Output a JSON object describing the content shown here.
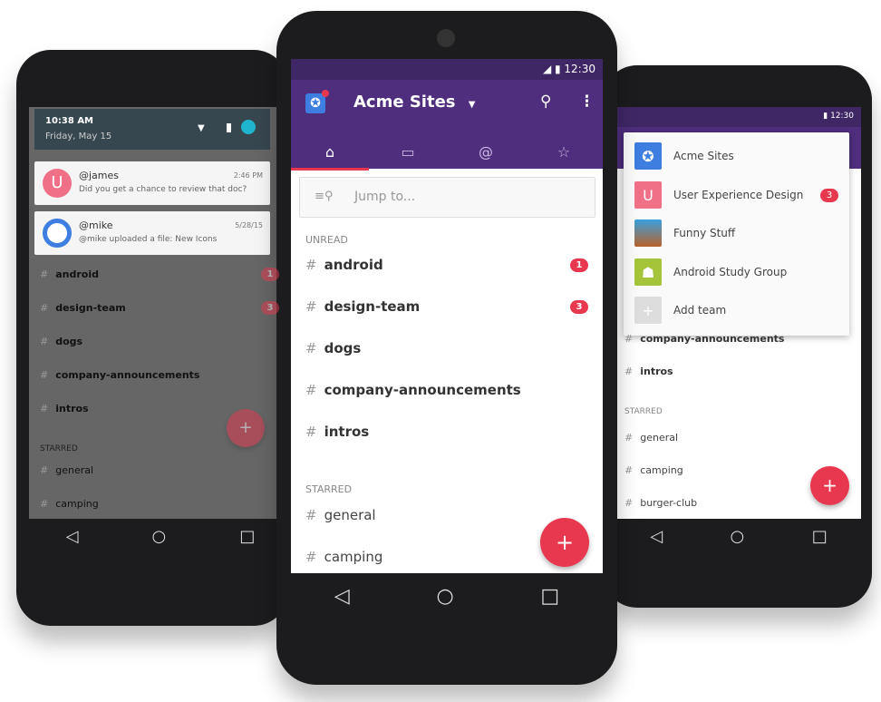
{
  "left": {
    "time": "10:38 AM",
    "date": "Friday, May 15",
    "notifications": [
      {
        "user": "@james",
        "time": "2:46 PM",
        "text": "Did you get a chance to review that doc?",
        "avatar": "U"
      },
      {
        "user": "@mike",
        "time": "5/28/15",
        "text": "@mike uploaded a file: New Icons"
      }
    ],
    "channels": [
      {
        "name": "android",
        "badge": "1"
      },
      {
        "name": "design-team",
        "badge": "3"
      },
      {
        "name": "dogs"
      },
      {
        "name": "company-announcements"
      },
      {
        "name": "intros"
      }
    ],
    "starred_label": "STARRED",
    "starred": [
      "general",
      "camping"
    ]
  },
  "center": {
    "status_time": "12:30",
    "team": "Acme Sites",
    "search_placeholder": "Jump to...",
    "unread_label": "UNREAD",
    "channels": [
      {
        "name": "android",
        "badge": "1"
      },
      {
        "name": "design-team",
        "badge": "3"
      },
      {
        "name": "dogs"
      },
      {
        "name": "company-announcements"
      },
      {
        "name": "intros"
      }
    ],
    "starred_label": "STARRED",
    "starred": [
      "general",
      "camping"
    ],
    "fab": "+"
  },
  "right": {
    "status_time": "12:30",
    "teams": [
      {
        "name": "Acme Sites"
      },
      {
        "name": "User Experience Design",
        "badge": "3",
        "avatar": "U"
      },
      {
        "name": "Funny Stuff"
      },
      {
        "name": "Android Study Group"
      },
      {
        "name": "Add team",
        "avatar": "+"
      }
    ],
    "channels": [
      "company-announcements",
      "intros"
    ],
    "starred_label": "STARRED",
    "starred": [
      "general",
      "camping",
      "burger-club"
    ],
    "fab": "+"
  },
  "colors": {
    "purple": "#4f2e7e",
    "purple_dark": "#3f2766",
    "accent": "#e8384f"
  },
  "hash": "#"
}
